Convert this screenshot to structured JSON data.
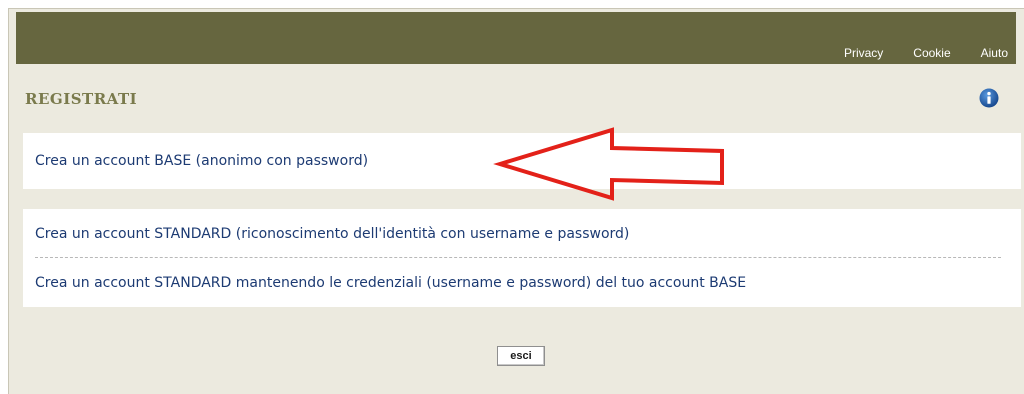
{
  "nav": {
    "items": [
      {
        "label": "Privacy"
      },
      {
        "label": "Cookie"
      },
      {
        "label": "Aiuto"
      }
    ]
  },
  "page": {
    "title": "REGISTRATI"
  },
  "accounts": {
    "base_link": "Crea un account BASE (anonimo con password)",
    "standard_link": "Crea un account STANDARD (riconoscimento dell'identità con username e password)",
    "standard_keep_link": "Crea un account STANDARD mantenendo le credenziali (username e password) del tuo account BASE"
  },
  "actions": {
    "exit_label": "esci"
  },
  "colors": {
    "header_bar": "#66663f",
    "panel_bg": "#eceadf",
    "title_text": "#7a7a4c",
    "link_text": "#1d3b73",
    "annotation_arrow": "#e32119",
    "info_icon": "#1f5fa8"
  },
  "icons": {
    "info": "info-circle-icon",
    "annotation": "red-arrow-annotation"
  }
}
